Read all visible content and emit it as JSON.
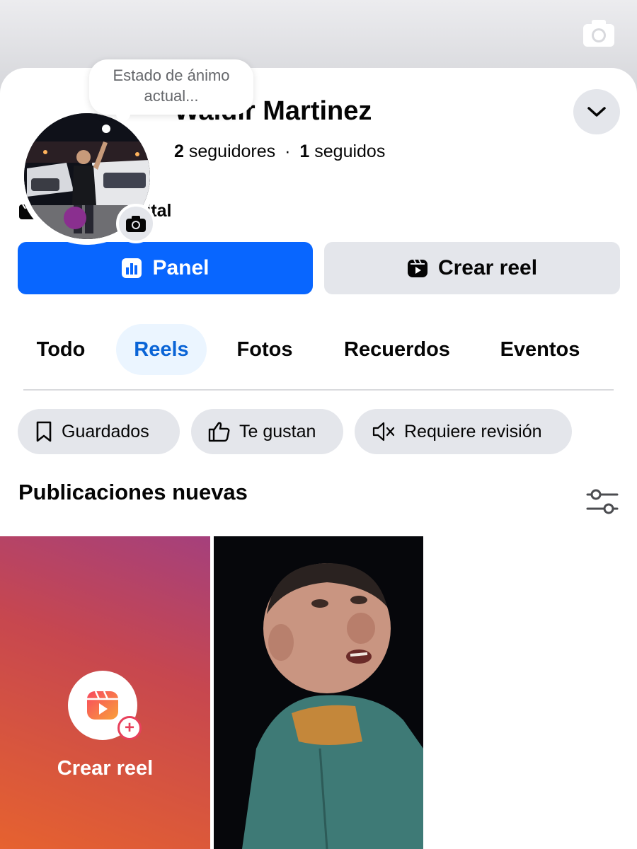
{
  "profile": {
    "mood_placeholder": "Estado de ánimo actual...",
    "name": "Waldir Martinez",
    "followers_count": "2",
    "followers_label": "seguidores",
    "separator": "·",
    "following_count": "1",
    "following_label": "seguidos",
    "category": "Creador digital"
  },
  "actions": {
    "panel_label": "Panel",
    "create_reel_label": "Crear reel"
  },
  "tabs": [
    {
      "label": "Todo",
      "active": false
    },
    {
      "label": "Reels",
      "active": true
    },
    {
      "label": "Fotos",
      "active": false
    },
    {
      "label": "Recuerdos",
      "active": false
    },
    {
      "label": "Eventos",
      "active": false
    }
  ],
  "chips": [
    {
      "label": "Guardados",
      "icon": "bookmark-icon"
    },
    {
      "label": "Te gustan",
      "icon": "thumbs-up-icon"
    },
    {
      "label": "Requiere revisión",
      "icon": "muted-speaker-icon"
    }
  ],
  "section": {
    "title": "Publicaciones nuevas"
  },
  "grid": {
    "create_tile_label": "Crear reel"
  },
  "colors": {
    "primary": "#0866ff",
    "active_tab_text": "#0a64d6",
    "active_tab_bg": "#ebf5ff",
    "secondary_button_bg": "#e4e6eb"
  }
}
